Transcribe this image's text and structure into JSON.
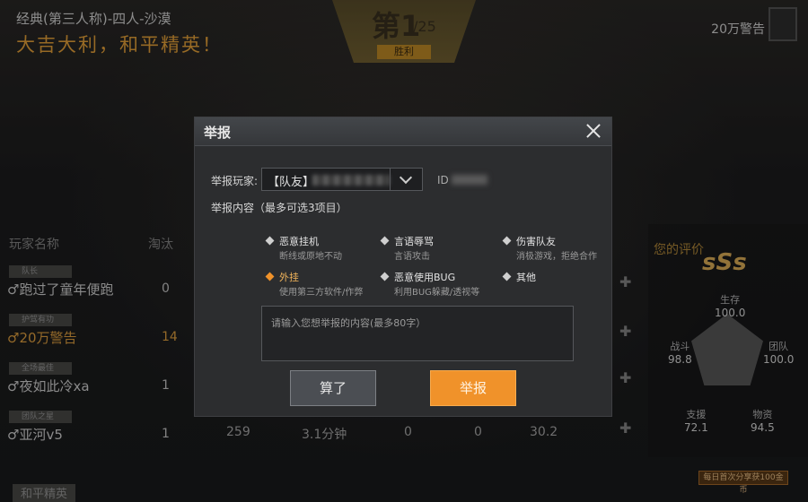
{
  "header": {
    "mode_title": "经典(第三人称)-四人-沙漠",
    "slogan": "大吉大利，和平精英！",
    "rank": "第1",
    "rank_total": "/25",
    "rank_badge": "胜利",
    "top_player": "20万警告"
  },
  "table": {
    "col_name": "玩家名称",
    "col_kills": "淘汰",
    "rows": [
      {
        "tag": "队长",
        "name": "♂跑过了童年便跑",
        "kills": "0"
      },
      {
        "tag": "护驾有功",
        "name": "♂20万警告",
        "kills": "14"
      },
      {
        "tag": "全场最佳",
        "name": "♂夜如此冷xa",
        "kills": "1"
      },
      {
        "tag": "团队之星",
        "name": "♂亚河v5",
        "kills": "1"
      }
    ],
    "last_row_extra": [
      "259",
      "3.1分钟",
      "0",
      "0",
      "30.2"
    ]
  },
  "rating": {
    "label": "您的评价",
    "grade": "sSs",
    "stats": {
      "top": {
        "label": "生存",
        "value": "100.0"
      },
      "left": {
        "label": "战斗",
        "value": "98.8"
      },
      "right": {
        "label": "团队",
        "value": "100.0"
      },
      "bl": {
        "label": "支援",
        "value": "72.1"
      },
      "br": {
        "label": "物资",
        "value": "94.5"
      }
    },
    "bottom_button": "每日首次分享获100金币",
    "bottom_tag": "和平精英"
  },
  "dialog": {
    "title": "举报",
    "player_label": "举报玩家:",
    "player_value": "【队友】",
    "id_label": "ID",
    "content_label": "举报内容（最多可选3项目）",
    "options": [
      {
        "title": "恶意挂机",
        "desc": "断线或原地不动",
        "selected": false
      },
      {
        "title": "言语辱骂",
        "desc": "言语攻击",
        "selected": false
      },
      {
        "title": "伤害队友",
        "desc": "消极游戏，拒绝合作",
        "selected": false
      },
      {
        "title": "外挂",
        "desc": "使用第三方软件/作弊",
        "selected": true
      },
      {
        "title": "恶意使用BUG",
        "desc": "利用BUG躲藏/透视等",
        "selected": false
      },
      {
        "title": "其他",
        "desc": "",
        "selected": false
      }
    ],
    "textarea_placeholder": "请输入您想举报的内容(最多80字）",
    "cancel_label": "算了",
    "submit_label": "举报"
  }
}
